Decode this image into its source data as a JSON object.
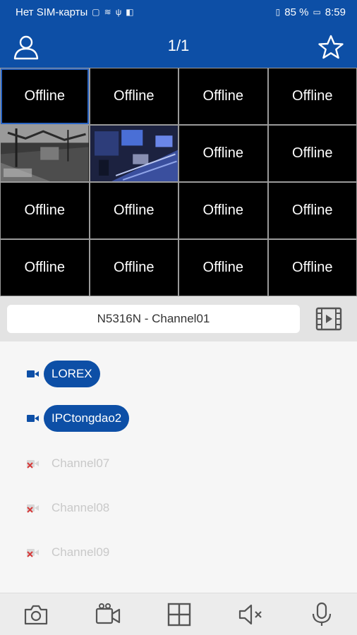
{
  "status_bar": {
    "carrier": "Нет SIM-карты",
    "battery": "85 %",
    "time": "8:59"
  },
  "header": {
    "page_counter": "1/1",
    "left_icon": "user-icon",
    "right_icon": "star-icon"
  },
  "grid": {
    "cells": [
      "Offline",
      "Offline",
      "Offline",
      "Offline",
      "",
      "",
      "Offline",
      "Offline",
      "Offline",
      "Offline",
      "Offline",
      "Offline",
      "Offline",
      "Offline",
      "Offline",
      "Offline"
    ]
  },
  "channel_bar": {
    "selected_channel": "N5316N - Channel01",
    "right_icon": "video-film-icon"
  },
  "channel_list": {
    "items": [
      {
        "label": "LOREX",
        "online": true
      },
      {
        "label": "IPCtongdao2",
        "online": true
      },
      {
        "label": "Channel07",
        "online": false
      },
      {
        "label": "Channel08",
        "online": false
      },
      {
        "label": "Channel09",
        "online": false
      }
    ]
  },
  "bottom_bar": {
    "icons": [
      "camera-snapshot-icon",
      "video-record-icon",
      "grid-layout-icon",
      "speaker-mute-icon",
      "microphone-icon"
    ]
  },
  "colors": {
    "primary": "#0d4fa6",
    "offline_text": "#c9c9c9",
    "offline_icon": "#d63a3a"
  }
}
